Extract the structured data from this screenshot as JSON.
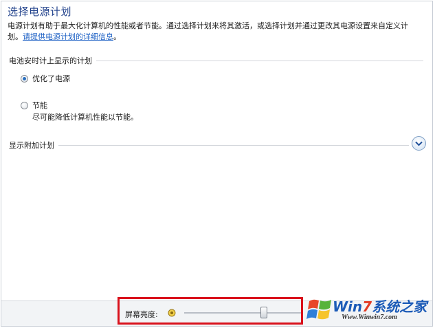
{
  "window": {
    "title": "选择电源计划"
  },
  "intro": {
    "text": "电源计划有助于最大化计算机的性能或者节能。通过选择计划来将其激活，或选择计划并通过更改其电源设置来自定义计划。",
    "link": "请提供电源计划的详细信息",
    "tail": "。"
  },
  "battery_section": {
    "label": "电池安时计上显示的计划"
  },
  "plans": [
    {
      "label": "优化了电源",
      "selected": true,
      "description": ""
    },
    {
      "label": "节能",
      "selected": false,
      "description": "尽可能降低计算机性能以节能。"
    }
  ],
  "additional_section": {
    "label": "显示附加计划",
    "icon": "chevron-down-icon"
  },
  "footer": {
    "brightness_label": "屏幕亮度:",
    "brightness_icon": "sun-icon",
    "brightness_level": 0.68,
    "highlight_color": "#d9111b"
  },
  "watermark": {
    "brand_prefix": "Wi",
    "brand_n": "n",
    "brand_seven": "7",
    "brand_suffix": "系统之家",
    "url": "Www.Winwin7.com"
  }
}
